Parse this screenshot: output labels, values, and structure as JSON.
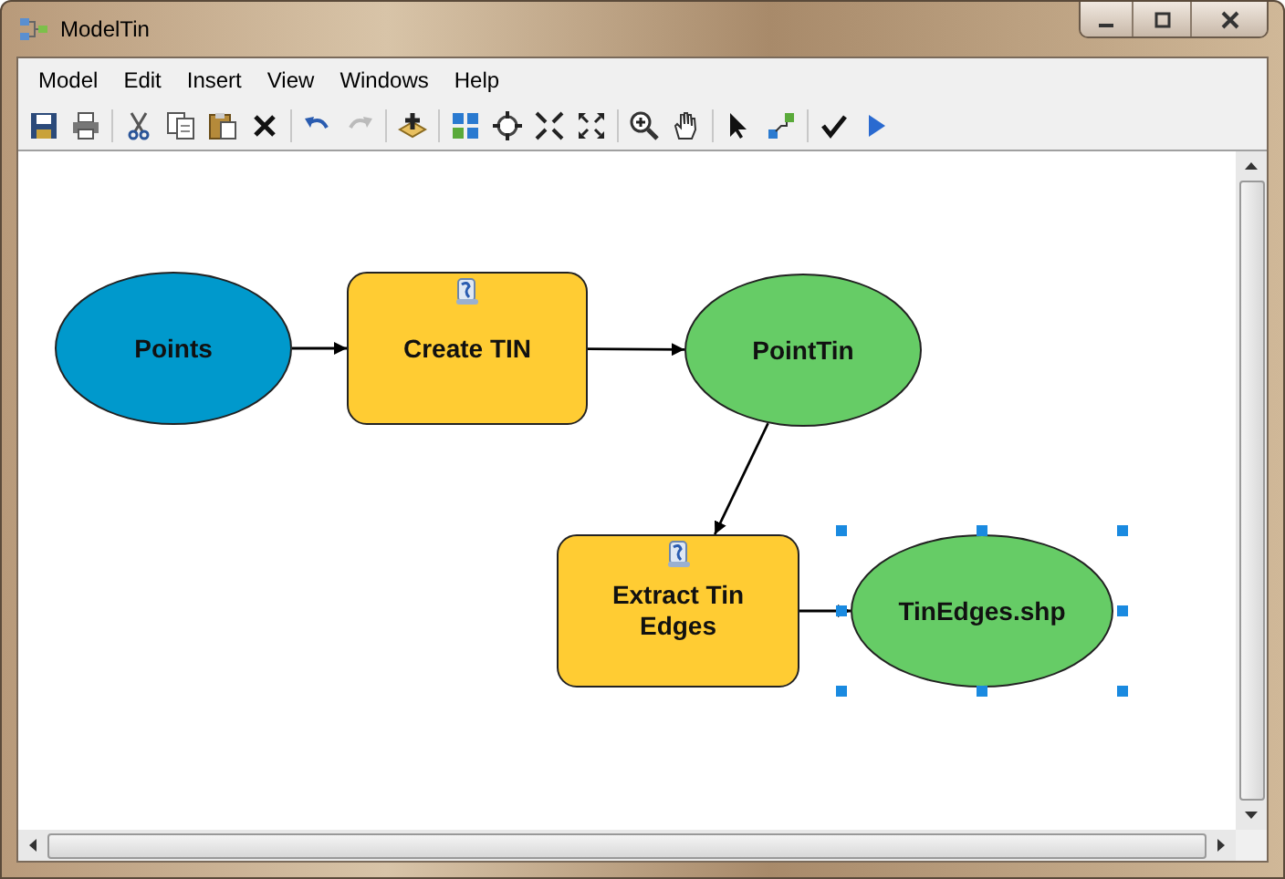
{
  "window": {
    "title": "ModelTin"
  },
  "menu": [
    "Model",
    "Edit",
    "Insert",
    "View",
    "Windows",
    "Help"
  ],
  "nodes": [
    {
      "kind": "data",
      "label": "Points",
      "color": "#0099cc",
      "selected": false
    },
    {
      "kind": "tool",
      "label": "Create TIN",
      "color": "#ffcc33",
      "selected": false
    },
    {
      "kind": "data",
      "label": "PointTin",
      "color": "#66cc66",
      "selected": false
    },
    {
      "kind": "tool",
      "label": "Extract Tin Edges",
      "color": "#ffcc33",
      "selected": false
    },
    {
      "kind": "data",
      "label": "TinEdges.shp",
      "color": "#66cc66",
      "selected": true
    }
  ]
}
